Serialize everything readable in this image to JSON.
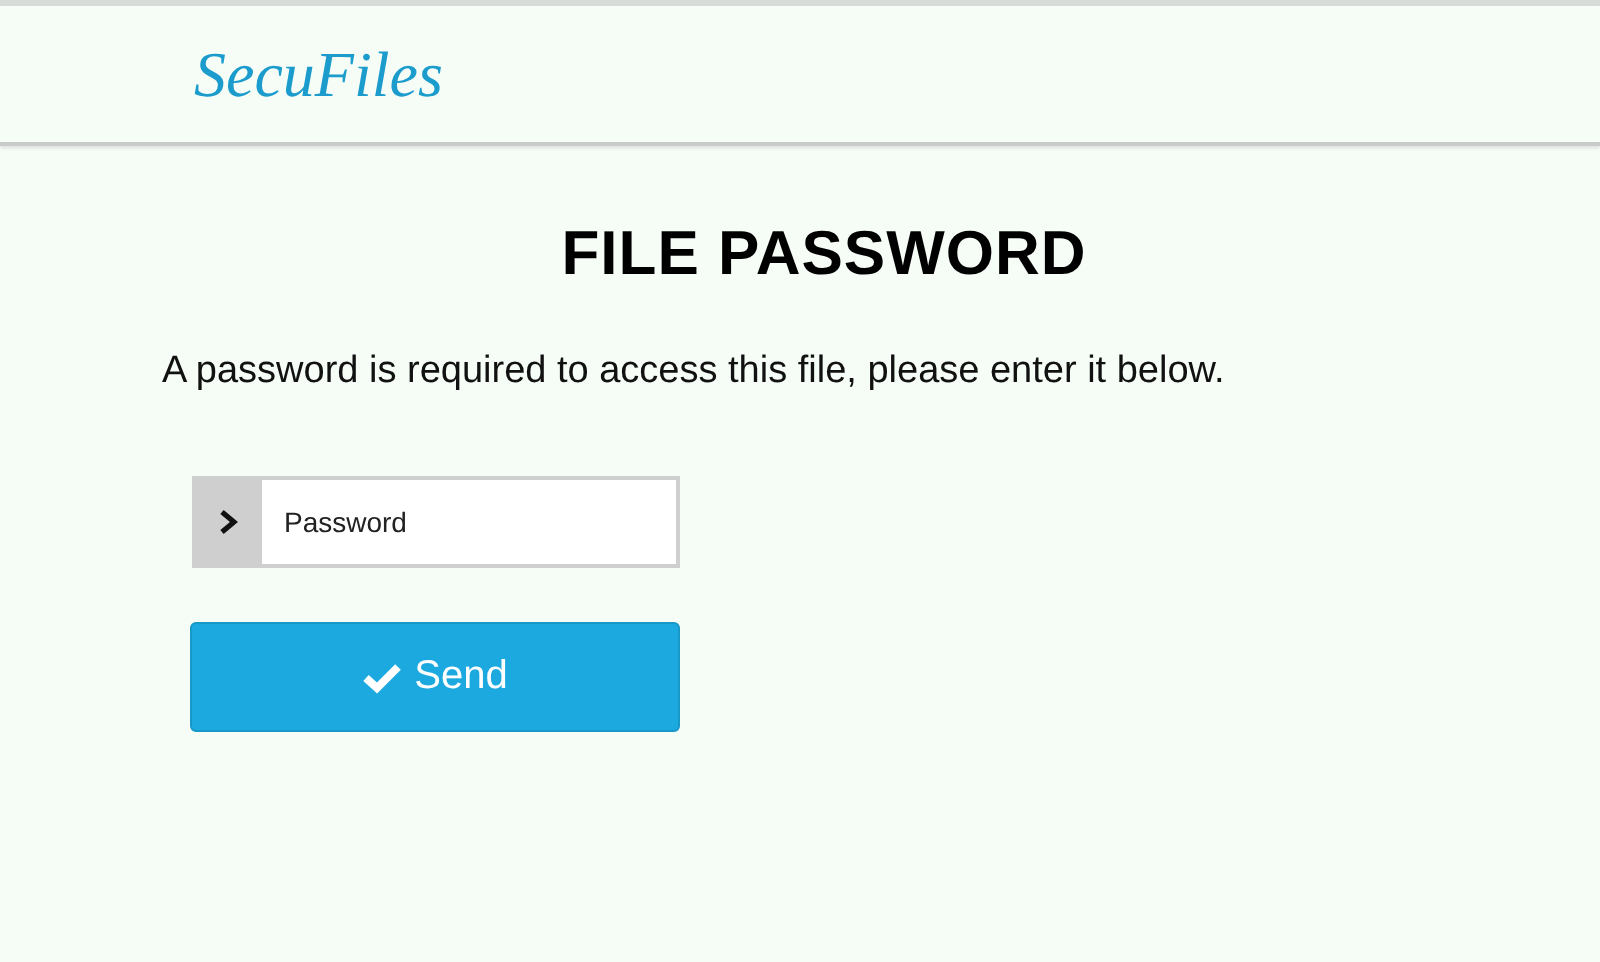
{
  "header": {
    "logo": "SecuFiles"
  },
  "title": "FILE PASSWORD",
  "message": "A password is required to access this file, please enter it below.",
  "password_field": {
    "placeholder": "Password"
  },
  "send_button": {
    "label": "Send"
  }
}
